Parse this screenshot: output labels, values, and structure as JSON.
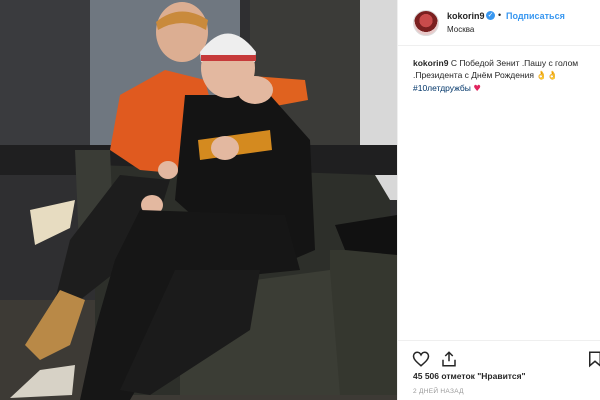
{
  "post": {
    "username": "kokorin9",
    "follow_label": "Подписаться",
    "separator": "•",
    "location": "Москва",
    "verified_mark": "✓"
  },
  "caption": {
    "username": "kokorin9",
    "text": "С Победой Зенит .Пашу с голом .Президента с Днём Рождения",
    "emojis": "👌👌",
    "hashtag": "#10летдружбы",
    "heart": "♥"
  },
  "stats": {
    "likes": "45 506 отметок \"Нравится\"",
    "time_ago": "2 ДНЕЙ НАЗАД"
  },
  "icons": [
    "heart-icon",
    "share-icon",
    "bookmark-icon"
  ],
  "colors": {
    "link_blue": "#3897f0",
    "hashtag": "#003569",
    "text": "#262626",
    "muted": "#999999"
  }
}
